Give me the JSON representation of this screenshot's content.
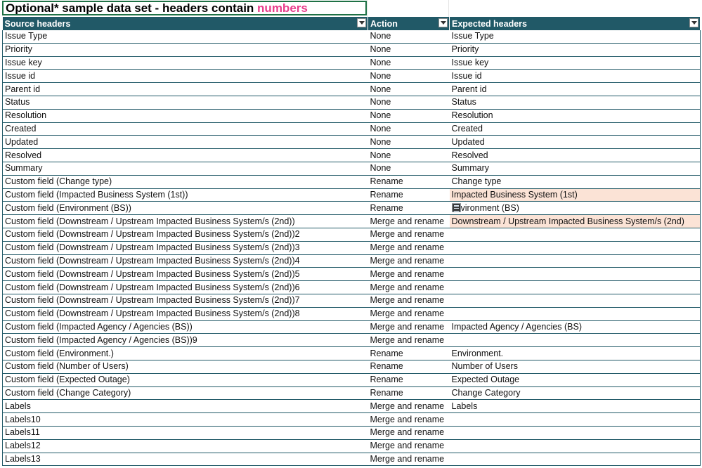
{
  "title": {
    "text_before": "Optional* sample data set - headers contain ",
    "highlight": "numbers"
  },
  "colors": {
    "header_bg": "#215967",
    "highlight_text": "#e83e8c",
    "peach_fill": "#fbe3d6"
  },
  "table": {
    "headers": [
      "Source headers",
      "Action",
      "Expected headers"
    ],
    "rows": [
      {
        "source": "Issue Type",
        "action": "None",
        "expected": "Issue Type"
      },
      {
        "source": "Priority",
        "action": "None",
        "expected": "Priority"
      },
      {
        "source": "Issue key",
        "action": "None",
        "expected": "Issue key"
      },
      {
        "source": "Issue id",
        "action": "None",
        "expected": "Issue id"
      },
      {
        "source": "Parent id",
        "action": "None",
        "expected": "Parent id"
      },
      {
        "source": "Status",
        "action": "None",
        "expected": "Status"
      },
      {
        "source": "Resolution",
        "action": "None",
        "expected": "Resolution"
      },
      {
        "source": "Created",
        "action": "None",
        "expected": "Created"
      },
      {
        "source": "Updated",
        "action": "None",
        "expected": "Updated"
      },
      {
        "source": "Resolved",
        "action": "None",
        "expected": "Resolved"
      },
      {
        "source": "Summary",
        "action": "None",
        "expected": "Summary"
      },
      {
        "source": "Custom field (Change type)",
        "action": "Rename",
        "expected": "Change type"
      },
      {
        "source": "Custom field (Impacted Business System (1st))",
        "action": "Rename",
        "expected": "Impacted Business System (1st)",
        "highlight": true
      },
      {
        "source": "Custom field (Environment (BS))",
        "action": "Rename",
        "expected": "vironment (BS)",
        "paste_icon": true
      },
      {
        "source": "Custom field (Downstream / Upstream Impacted Business System/s (2nd))",
        "action": "Merge and rename",
        "expected": "Downstream / Upstream Impacted Business System/s (2nd)",
        "highlight": true
      },
      {
        "source": "Custom field (Downstream / Upstream Impacted Business System/s (2nd))2",
        "action": "Merge and rename",
        "expected": ""
      },
      {
        "source": "Custom field (Downstream / Upstream Impacted Business System/s (2nd))3",
        "action": "Merge and rename",
        "expected": ""
      },
      {
        "source": "Custom field (Downstream / Upstream Impacted Business System/s (2nd))4",
        "action": "Merge and rename",
        "expected": ""
      },
      {
        "source": "Custom field (Downstream / Upstream Impacted Business System/s (2nd))5",
        "action": "Merge and rename",
        "expected": ""
      },
      {
        "source": "Custom field (Downstream / Upstream Impacted Business System/s (2nd))6",
        "action": "Merge and rename",
        "expected": ""
      },
      {
        "source": "Custom field (Downstream / Upstream Impacted Business System/s (2nd))7",
        "action": "Merge and rename",
        "expected": ""
      },
      {
        "source": "Custom field (Downstream / Upstream Impacted Business System/s (2nd))8",
        "action": "Merge and rename",
        "expected": ""
      },
      {
        "source": "Custom field (Impacted Agency / Agencies (BS))",
        "action": "Merge and rename",
        "expected": "Impacted Agency / Agencies (BS)"
      },
      {
        "source": "Custom field (Impacted Agency / Agencies (BS))9",
        "action": "Merge and rename",
        "expected": ""
      },
      {
        "source": "Custom field (Environment.)",
        "action": "Rename",
        "expected": "Environment."
      },
      {
        "source": "Custom field (Number of Users)",
        "action": "Rename",
        "expected": "Number of Users"
      },
      {
        "source": "Custom field (Expected Outage)",
        "action": "Rename",
        "expected": "Expected Outage"
      },
      {
        "source": "Custom field (Change Category)",
        "action": "Rename",
        "expected": "Change Category"
      },
      {
        "source": "Labels",
        "action": "Merge and rename",
        "expected": "Labels"
      },
      {
        "source": "Labels10",
        "action": "Merge and rename",
        "expected": ""
      },
      {
        "source": "Labels11",
        "action": "Merge and rename",
        "expected": ""
      },
      {
        "source": "Labels12",
        "action": "Merge and rename",
        "expected": ""
      },
      {
        "source": "Labels13",
        "action": "Merge and rename",
        "expected": ""
      }
    ]
  }
}
